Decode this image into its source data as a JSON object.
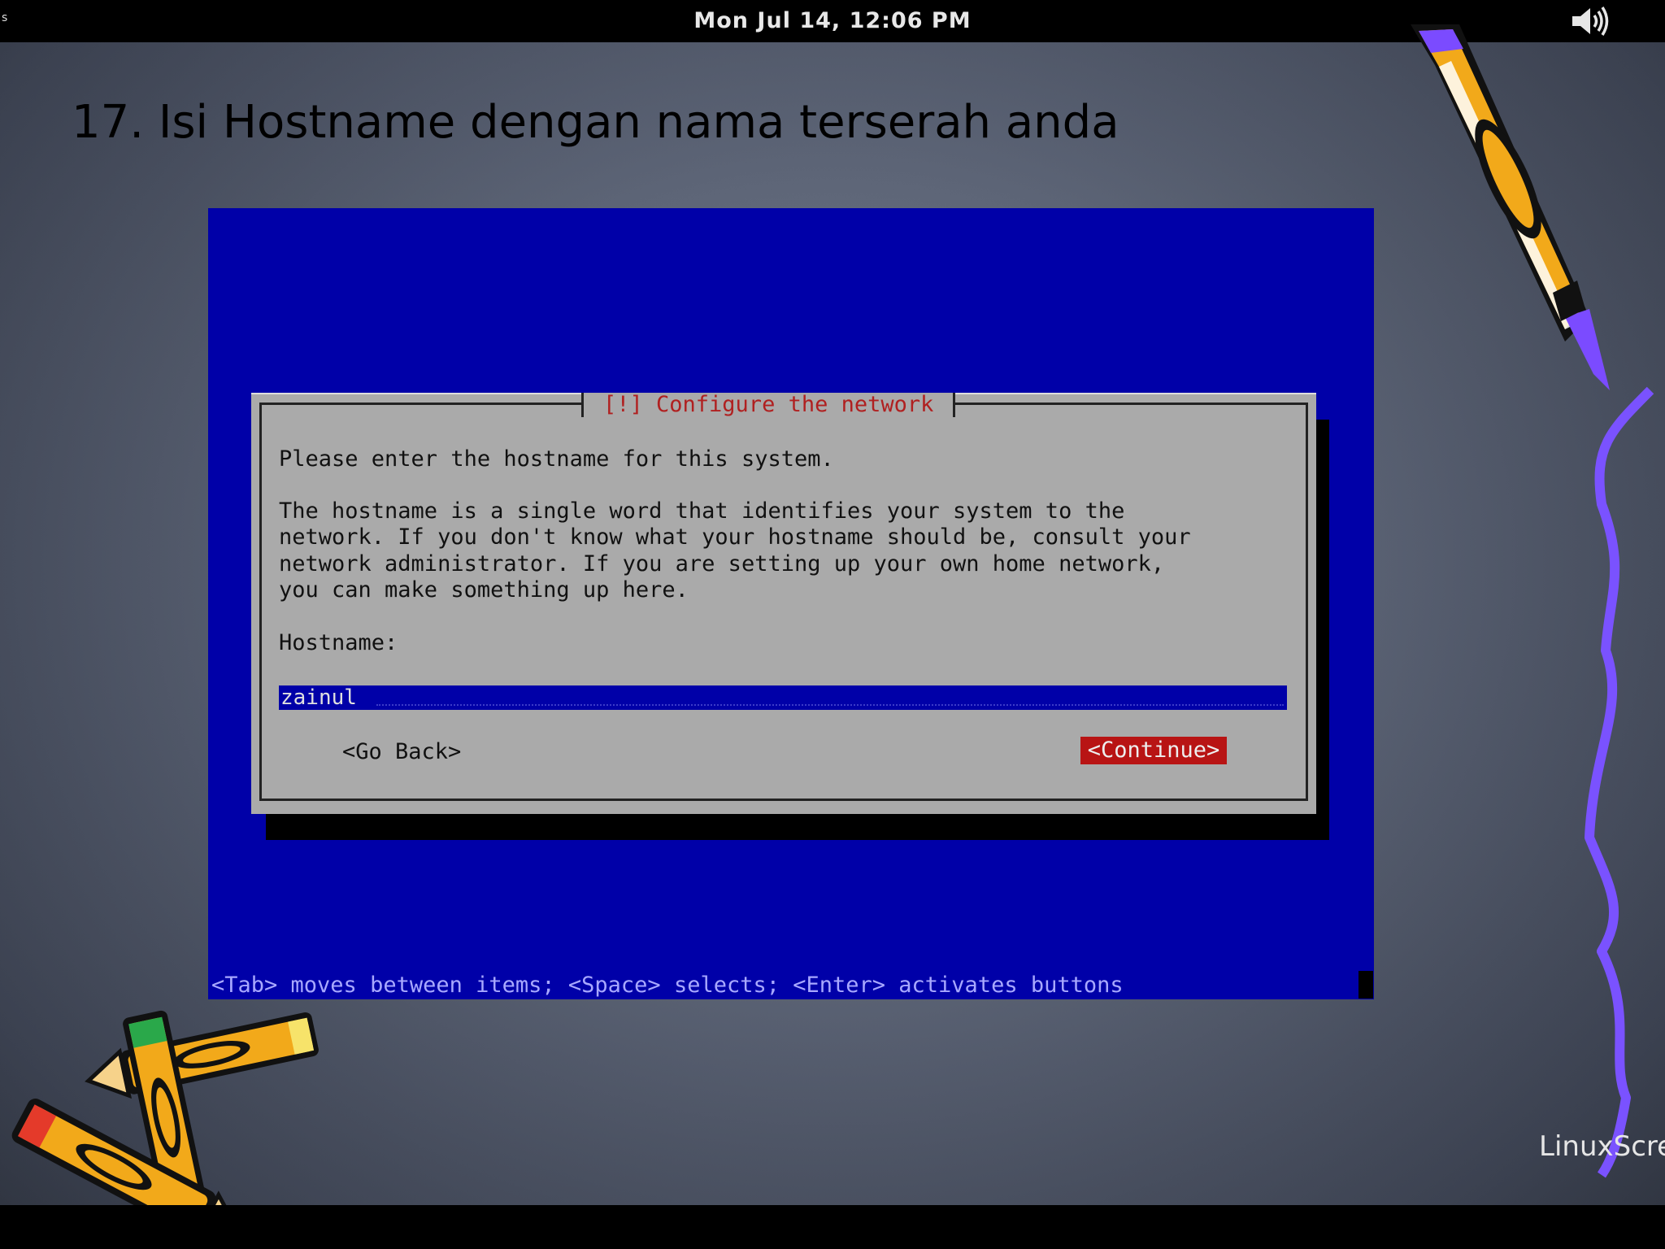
{
  "topbar": {
    "left_mark": "s",
    "clock": "Mon Jul 14, 12:06 PM",
    "volume_icon": "speaker-volume-icon"
  },
  "slide": {
    "title": "17. Isi Hostname dengan nama terserah anda"
  },
  "installer": {
    "dialog_title": "[!] Configure the network",
    "prompt": "Please enter the hostname for this system.",
    "description_lines": [
      "The hostname is a single word that identifies your system to the",
      "network. If you don't know what your hostname should be, consult your",
      "network administrator. If you are setting up your own home network,",
      "you can make something up here."
    ],
    "hostname_label": "Hostname:",
    "hostname_value": "zainul",
    "back_button": "<Go Back>",
    "continue_button": "<Continue>",
    "help_line": "<Tab> moves between items; <Space> selects; <Enter> activates buttons"
  },
  "watermark": "LinuxScre",
  "colors": {
    "installer_bg": "#0000a8",
    "dialog_bg": "#aaaaaa",
    "title_red": "#b02020",
    "button_active": "#b81414"
  }
}
